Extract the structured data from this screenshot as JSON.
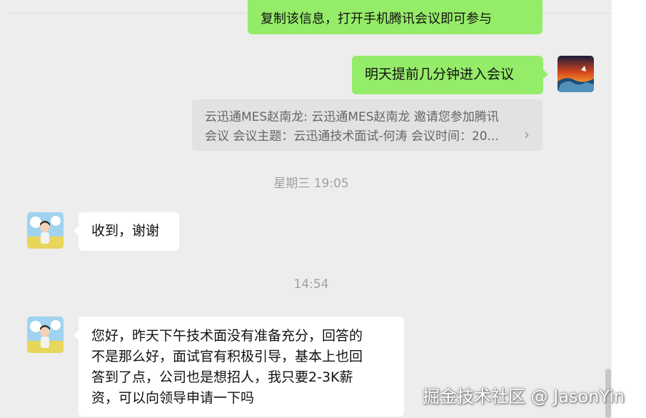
{
  "messages": {
    "partial_top_text": "复制该信息，打开手机腾讯会议即可参与",
    "sent_tomorrow": "明天提前几分钟进入会议",
    "quoted_line1": "云迅通MES赵南龙: 云迅通MES赵南龙 邀请您参加腾讯",
    "quoted_line2": "会议 会议主题：云迅通技术面试-何涛 会议时间：20...",
    "received_thanks": "收到，谢谢",
    "long_line1": "您好，昨天下午技术面没有准备充分，回答的",
    "long_line2": "不是那么好，面试官有积极引导，基本上也回",
    "long_line3": "答到了点，公司也是想招人，我只要2-3K薪",
    "long_line4": "资，可以向领导申请一下吗"
  },
  "timestamps": {
    "ts1": "星期三 19:05",
    "ts2": "14:54"
  },
  "icons": {
    "quote_chevron": "›"
  },
  "watermark": "掘金技术社区 @ JasonYin",
  "colors": {
    "background": "#ededed",
    "sent_bubble": "#95ec69",
    "received_bubble": "#ffffff",
    "quote_bg": "#e2e2e2",
    "timestamp": "#a0a0a0"
  }
}
